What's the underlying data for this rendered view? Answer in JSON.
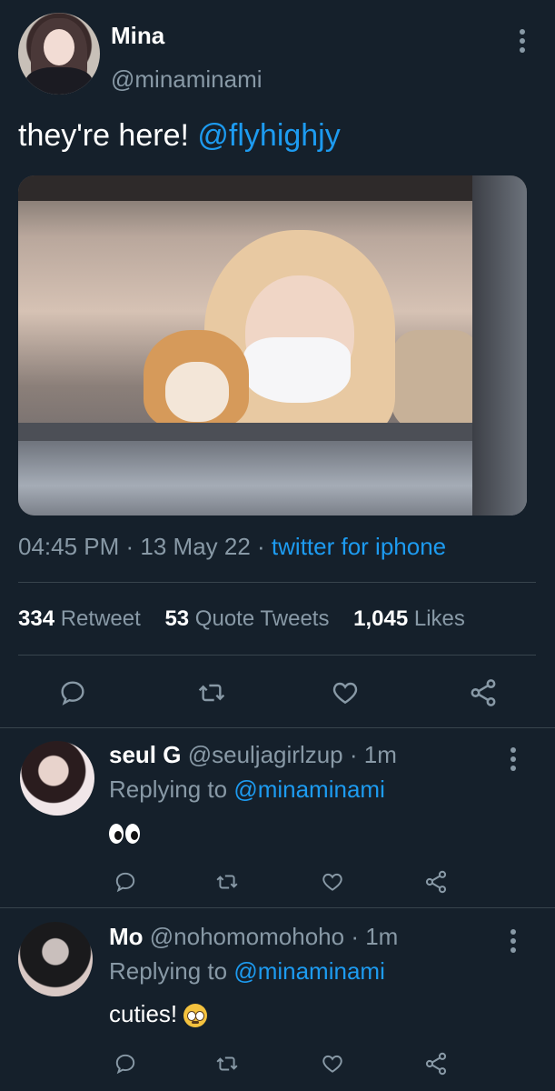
{
  "tweet": {
    "author_name": "Mina",
    "author_handle": "@minaminami",
    "text_plain": "they're here! ",
    "text_mention": "@flyhighjy",
    "time": "04:45 PM",
    "date": "13 May 22",
    "separator": " · ",
    "source": "twitter for iphone",
    "stats": {
      "retweets_count": "334",
      "retweets_label": " Retweet",
      "quotes_count": "53",
      "quotes_label": " Quote Tweets",
      "likes_count": "1,045",
      "likes_label": " Likes"
    }
  },
  "replies": [
    {
      "name": "seul G",
      "handle": "@seuljagirlzup",
      "time_sep": " · ",
      "time": "1m",
      "replying_prefix": "Replying to ",
      "replying_to": "@minaminami",
      "text": "",
      "emoji": "eyes"
    },
    {
      "name": "Mo",
      "handle": "@nohomomohoho",
      "time_sep": " · ",
      "time": "1m",
      "replying_prefix": "Replying to ",
      "replying_to": "@minaminami",
      "text": "cuties! ",
      "emoji": "pleading-face"
    }
  ],
  "colors": {
    "background": "#15202b",
    "accent": "#1d9bf0",
    "secondary_text": "#8899a6",
    "divider": "#38444d"
  },
  "icons": [
    "more-vertical-icon",
    "reply-icon",
    "retweet-icon",
    "like-icon",
    "share-icon"
  ]
}
